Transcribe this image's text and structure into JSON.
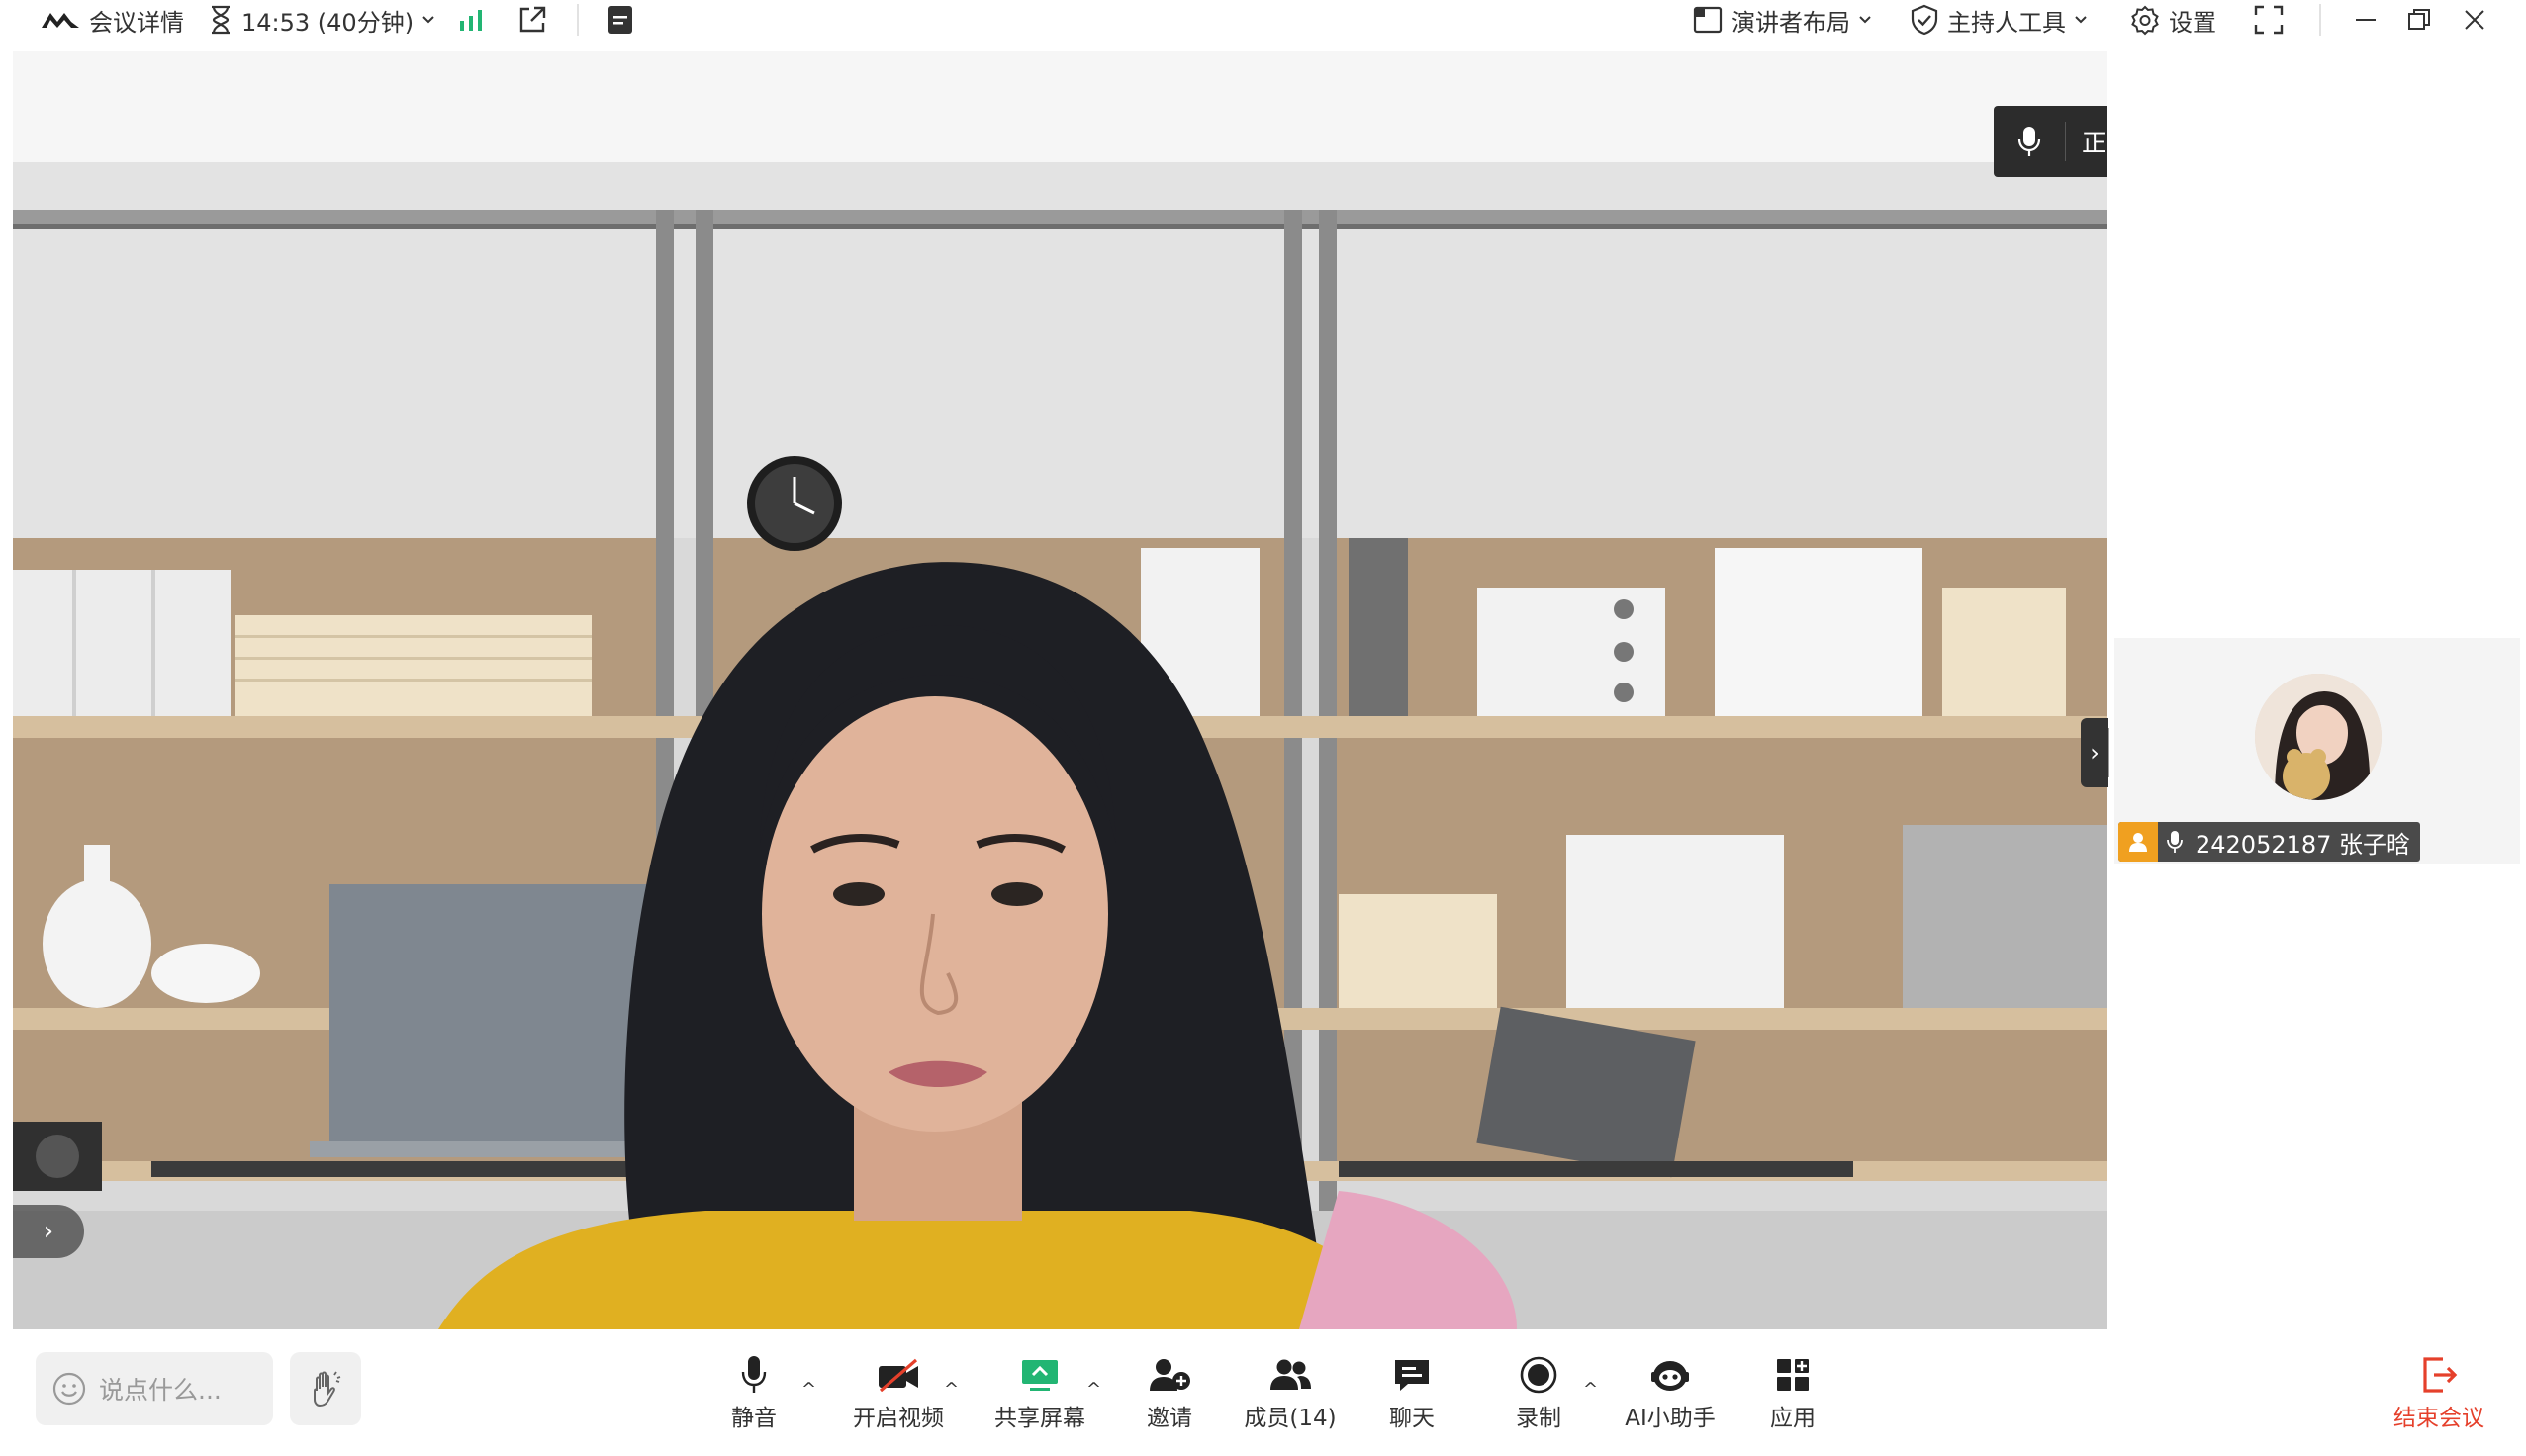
{
  "topbar": {
    "meeting_details": "会议详情",
    "timer": "14:53 (40分钟)",
    "speaker_layout": "演讲者布局",
    "host_tools": "主持人工具",
    "settings": "设置"
  },
  "stage": {
    "speaking_label": "正在讲话:"
  },
  "participant": {
    "name": "242052187 张子晗"
  },
  "bottombar": {
    "chat_placeholder": "说点什么...",
    "mute": "静音",
    "start_video": "开启视频",
    "share_screen": "共享屏幕",
    "invite": "邀请",
    "members": "成员(14)",
    "chat": "聊天",
    "record": "录制",
    "ai_assistant": "AI小助手",
    "apps": "应用",
    "end_meeting": "结束会议"
  },
  "colors": {
    "accent_green": "#22b573",
    "end_red": "#e5402b",
    "host_orange": "#f0a020",
    "banner_dark": "#2c2c2c"
  }
}
